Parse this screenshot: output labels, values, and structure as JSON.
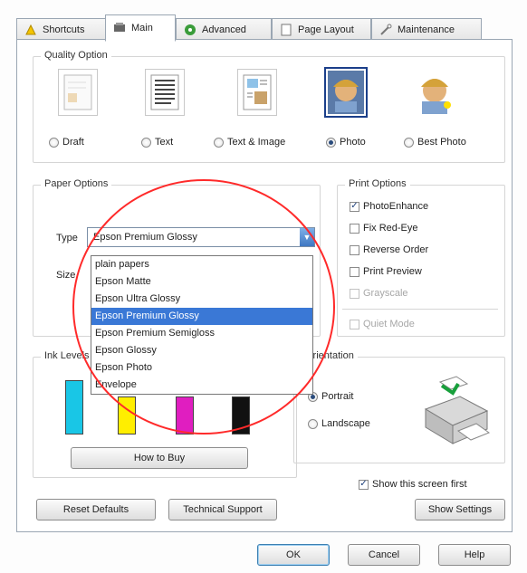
{
  "tabs": [
    {
      "label": "Shortcuts",
      "icon": "shortcuts-icon"
    },
    {
      "label": "Main",
      "icon": "main-settings-icon",
      "active": true
    },
    {
      "label": "Advanced",
      "icon": "advanced-icon"
    },
    {
      "label": "Page Layout",
      "icon": "page-layout-icon"
    },
    {
      "label": "Maintenance",
      "icon": "maintenance-icon"
    }
  ],
  "quality": {
    "title": "Quality Option",
    "options": [
      {
        "label": "Draft",
        "icon": "draft-quality-icon",
        "selected": false
      },
      {
        "label": "Text",
        "icon": "text-quality-icon",
        "selected": false
      },
      {
        "label": "Text & Image",
        "icon": "text-image-quality-icon",
        "selected": false
      },
      {
        "label": "Photo",
        "icon": "photo-quality-icon",
        "selected": true
      },
      {
        "label": "Best Photo",
        "icon": "best-photo-quality-icon",
        "selected": false
      }
    ]
  },
  "paper": {
    "title": "Paper Options",
    "type_label": "Type",
    "type_value": "Epson Premium Glossy",
    "size_label": "Size",
    "type_options": [
      "plain papers",
      "Epson Matte",
      "Epson Ultra Glossy",
      "Epson Premium Glossy",
      "Epson Premium Semigloss",
      "Epson Glossy",
      "Epson Photo",
      "Envelope"
    ],
    "selected_index": 3
  },
  "print_options": {
    "title": "Print Options",
    "items": [
      {
        "label": "PhotoEnhance",
        "checked": true,
        "disabled": false
      },
      {
        "label": "Fix Red-Eye",
        "checked": false,
        "disabled": false
      },
      {
        "label": "Reverse Order",
        "checked": false,
        "disabled": false
      },
      {
        "label": "Print Preview",
        "checked": false,
        "disabled": false
      },
      {
        "label": "Grayscale",
        "checked": false,
        "disabled": true
      }
    ],
    "quiet_mode": {
      "label": "Quiet Mode",
      "checked": false,
      "disabled": true
    }
  },
  "ink": {
    "title": "Ink Levels",
    "colors": [
      "#19c6e6",
      "#ffee00",
      "#e01ec0",
      "#111111"
    ],
    "how_to_buy": "How to Buy"
  },
  "orientation": {
    "title": "Orientation",
    "portrait": "Portrait",
    "landscape": "Landscape",
    "selected": "portrait"
  },
  "show_first": {
    "label": "Show this screen first",
    "checked": true
  },
  "buttons": {
    "reset": "Reset Defaults",
    "support": "Technical Support",
    "show_settings": "Show Settings",
    "ok": "OK",
    "cancel": "Cancel",
    "help": "Help"
  },
  "colors": {
    "highlight": "#3a78d6",
    "annotation": "#ff2a2a"
  }
}
